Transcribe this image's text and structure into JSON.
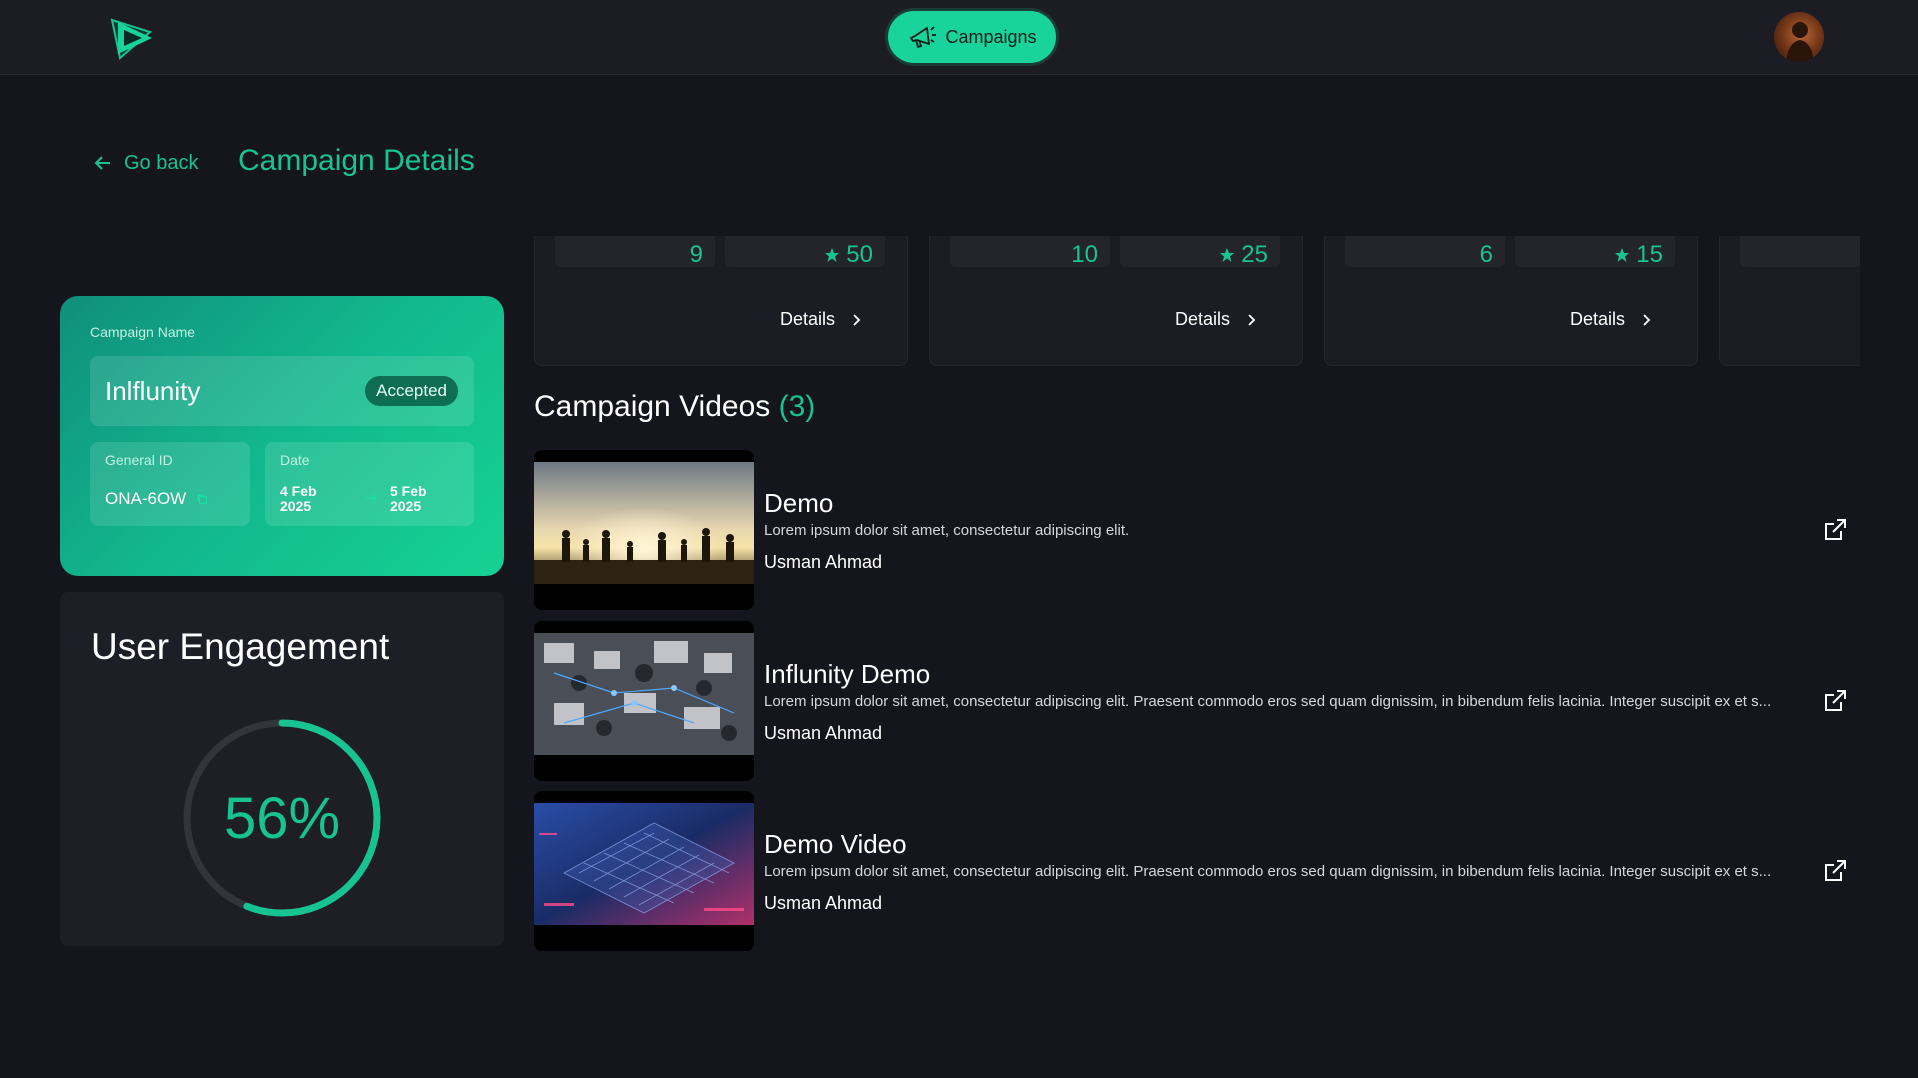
{
  "header": {
    "logo_icon": "play-logo-icon",
    "nav_pill": {
      "label": "Campaigns",
      "icon": "megaphone-icon"
    },
    "avatar_icon": "user-avatar"
  },
  "page": {
    "go_back_label": "Go back",
    "title": "Campaign Details"
  },
  "campaign": {
    "name_label": "Campaign Name",
    "name": "Inlflunity",
    "status": "Accepted",
    "general_id_label": "General ID",
    "general_id": "ONA-6OW",
    "date_label": "Date",
    "date_from_line1": "4 Feb",
    "date_from_line2": "2025",
    "date_to_line1": "5 Feb",
    "date_to_line2": "2025"
  },
  "engagement": {
    "title": "User Engagement",
    "percent": 56,
    "percent_label": "56%"
  },
  "stat_cards": [
    {
      "left_value": "9",
      "right_value": "50",
      "details_label": "Details"
    },
    {
      "left_value": "10",
      "right_value": "25",
      "details_label": "Details"
    },
    {
      "left_value": "6",
      "right_value": "15",
      "details_label": "Details"
    }
  ],
  "videos": {
    "title": "Campaign Videos",
    "count": "(3)",
    "items": [
      {
        "title": "Demo",
        "description": "Lorem ipsum dolor sit amet, consectetur adipiscing elit.",
        "author": "Usman Ahmad"
      },
      {
        "title": "Influnity Demo",
        "description": "Lorem ipsum dolor sit amet, consectetur adipiscing elit. Praesent commodo eros sed quam dignissim, in bibendum felis lacinia. Integer suscipit ex et s...",
        "author": "Usman Ahmad"
      },
      {
        "title": "Demo Video",
        "description": "Lorem ipsum dolor sit amet, consectetur adipiscing elit. Praesent commodo eros sed quam dignissim, in bibendum felis lacinia. Integer suscipit ex et s...",
        "author": "Usman Ahmad"
      }
    ]
  },
  "colors": {
    "accent": "#18c393",
    "background": "#15151d",
    "card": "#1e1e26"
  }
}
